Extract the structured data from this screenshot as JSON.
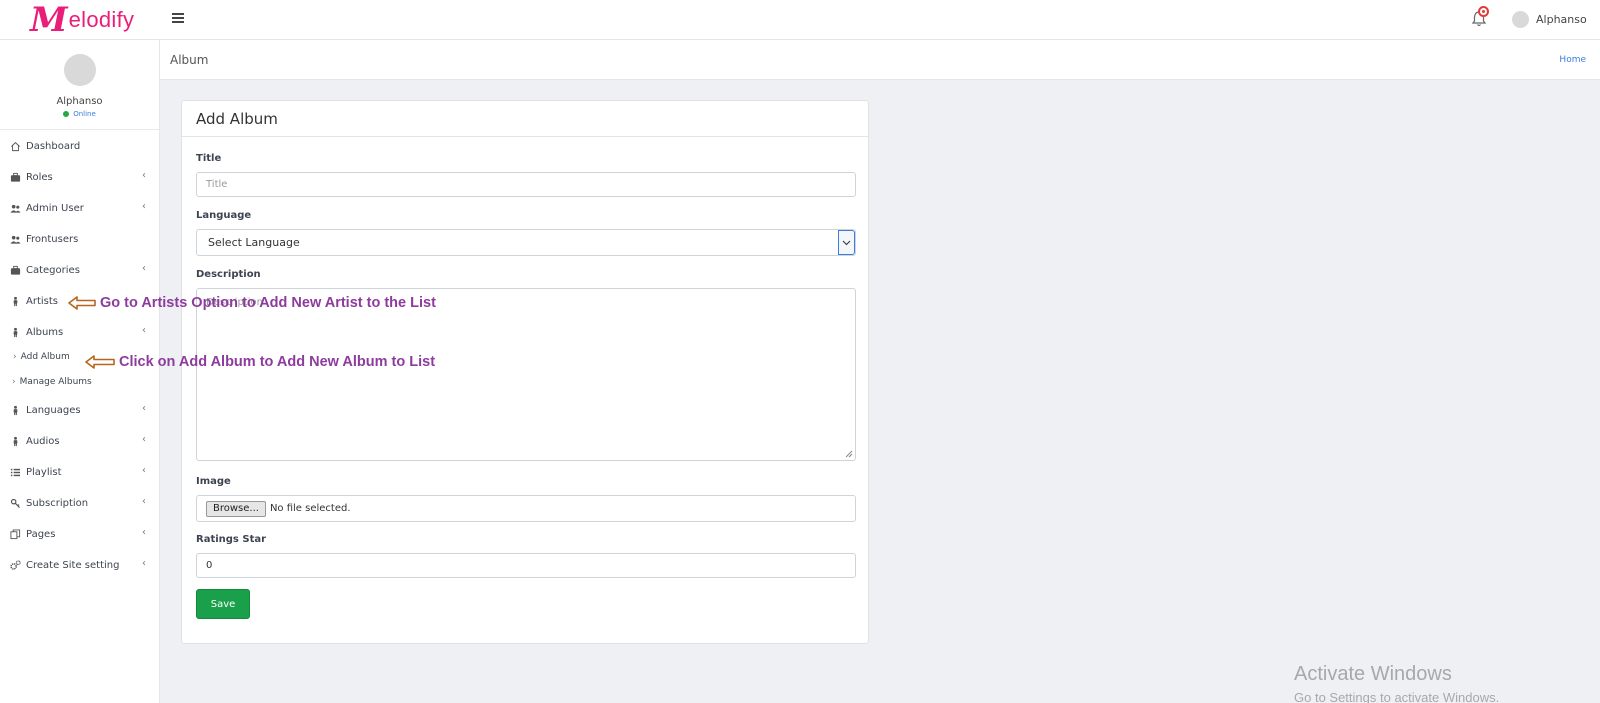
{
  "app": {
    "logo_text": "elodify",
    "logo_letter": "M",
    "brand_color": "#e91e7a"
  },
  "topbar": {
    "user_name": "Alphanso",
    "menu_icon": "hamburger-icon",
    "bell_icon": "bell-icon"
  },
  "sidebar": {
    "profile": {
      "name": "Alphanso",
      "status": "Online"
    },
    "items": [
      {
        "label": "Dashboard",
        "icon": "home-icon"
      },
      {
        "label": "Roles",
        "icon": "briefcase-icon"
      },
      {
        "label": "Admin User",
        "icon": "users-icon"
      },
      {
        "label": "Frontusers",
        "icon": "users-icon"
      },
      {
        "label": "Categories",
        "icon": "briefcase-icon"
      },
      {
        "label": "Artists",
        "icon": "person-icon"
      },
      {
        "label": "Albums",
        "icon": "person-icon"
      },
      {
        "label": "Languages",
        "icon": "person-icon"
      },
      {
        "label": "Audios",
        "icon": "person-icon"
      },
      {
        "label": "Playlist",
        "icon": "list-icon"
      },
      {
        "label": "Subscription",
        "icon": "key-icon"
      },
      {
        "label": "Pages",
        "icon": "copy-icon"
      },
      {
        "label": "Create Site setting",
        "icon": "gears-icon"
      }
    ],
    "sub_items": [
      {
        "label": "Add Album"
      },
      {
        "label": "Manage Albums"
      }
    ],
    "chevron": "‹"
  },
  "annotations": {
    "artists": "Go to Artists Option to Add New Artist to the List",
    "add_album": "Click on Add Album to Add New Album to List",
    "arrow_color": "#b5651d"
  },
  "header": {
    "title": "Album",
    "breadcrumb_home": "Home"
  },
  "form": {
    "heading": "Add Album",
    "title_label": "Title",
    "title_placeholder": "Title",
    "language_label": "Language",
    "language_value": "Select Language",
    "description_label": "Description",
    "description_placeholder": "Description",
    "image_label": "Image",
    "browse_label": "Browse...",
    "file_status": "No file selected.",
    "rating_label": "Ratings Star",
    "rating_value": "0",
    "save_label": "Save",
    "save_color": "#1aa04a"
  },
  "watermark": {
    "title": "Activate Windows",
    "subtitle": "Go to Settings to activate Windows."
  }
}
